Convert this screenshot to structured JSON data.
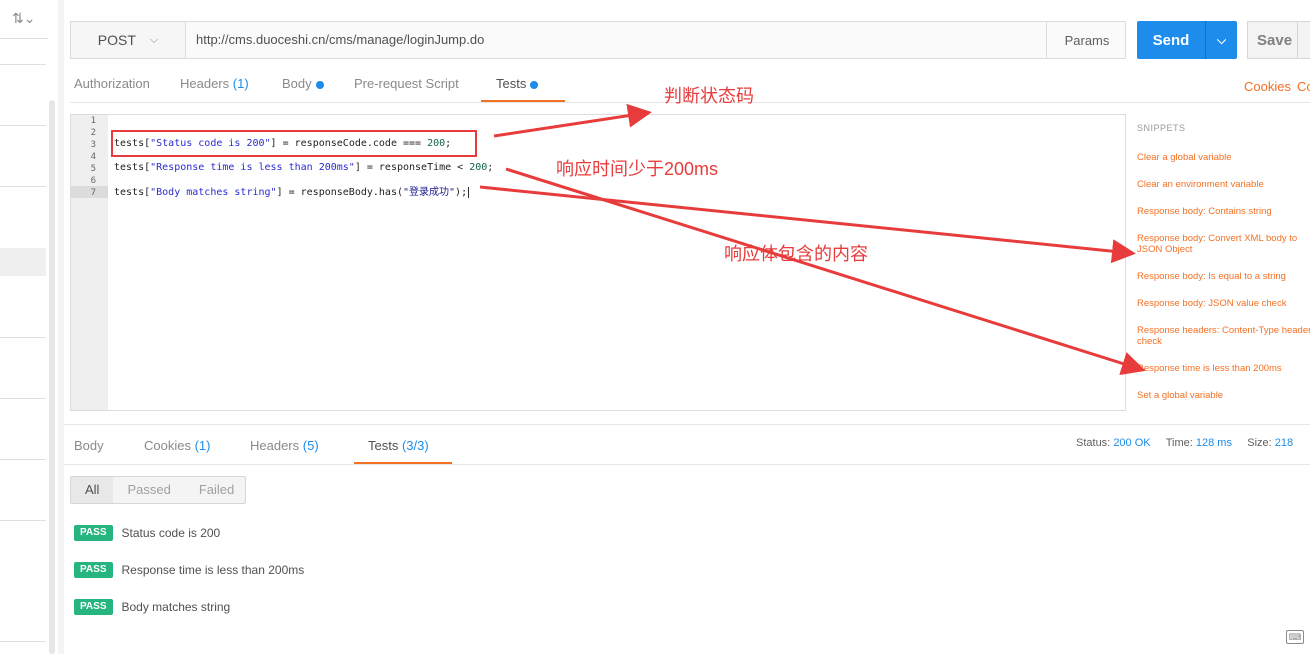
{
  "request": {
    "method": "POST",
    "url": "http://cms.duoceshi.cn/cms/manage/loginJump.do",
    "params_label": "Params",
    "send_label": "Send",
    "save_label": "Save"
  },
  "request_tabs": [
    {
      "label": "Authorization",
      "count": "",
      "dot": false
    },
    {
      "label": "Headers",
      "count": "(1)",
      "dot": false
    },
    {
      "label": "Body",
      "count": "",
      "dot": true
    },
    {
      "label": "Pre-request Script",
      "count": "",
      "dot": false
    },
    {
      "label": "Tests",
      "count": "",
      "dot": true
    }
  ],
  "links": {
    "cookies": "Cookies",
    "code": "Co"
  },
  "editor": {
    "line_numbers": [
      "1",
      "2",
      "3",
      "4",
      "5",
      "6",
      "7"
    ],
    "lines": [
      {
        "prefix": "tests[",
        "str": "\"Status code is 200\"",
        "rest": "] = responseCode.code === ",
        "num": "200",
        "tail": ";"
      },
      {
        "prefix": "tests[",
        "str": "\"Response time is less than 200ms\"",
        "rest": "] = responseTime < ",
        "num": "200",
        "tail": ";"
      },
      {
        "prefix": "tests[",
        "str": "\"Body matches string\"",
        "rest": "] = responseBody.has(",
        "num": "\"登录成功\"",
        "tail": ");"
      }
    ]
  },
  "snippets": {
    "title": "SNIPPETS",
    "items": [
      "Clear a global variable",
      "Clear an environment variable",
      "Response body: Contains string",
      "Response body: Convert XML body to JSON Object",
      "Response body: Is equal to a string",
      "Response body: JSON value check",
      "Response headers: Content-Type header check",
      "Response time is less than 200ms",
      "Set a global variable"
    ]
  },
  "annotations": {
    "status": "判断状态码",
    "time": "响应时间少于200ms",
    "body": "响应体包含的内容"
  },
  "response_tabs": [
    {
      "label": "Body",
      "count": ""
    },
    {
      "label": "Cookies",
      "count": "(1)"
    },
    {
      "label": "Headers",
      "count": "(5)"
    },
    {
      "label": "Tests",
      "count": "(3/3)"
    }
  ],
  "response_status": {
    "status_label": "Status:",
    "status_value": "200 OK",
    "time_label": "Time:",
    "time_value": "128 ms",
    "size_label": "Size:",
    "size_value": "218"
  },
  "filters": [
    "All",
    "Passed",
    "Failed"
  ],
  "results": [
    {
      "badge": "PASS",
      "name": "Status code is 200"
    },
    {
      "badge": "PASS",
      "name": "Response time is less than 200ms"
    },
    {
      "badge": "PASS",
      "name": "Body matches string"
    }
  ],
  "colors": {
    "accent": "#f47023",
    "send": "#1d8cea",
    "pass": "#26b47f",
    "annotation": "#e83c3c"
  }
}
